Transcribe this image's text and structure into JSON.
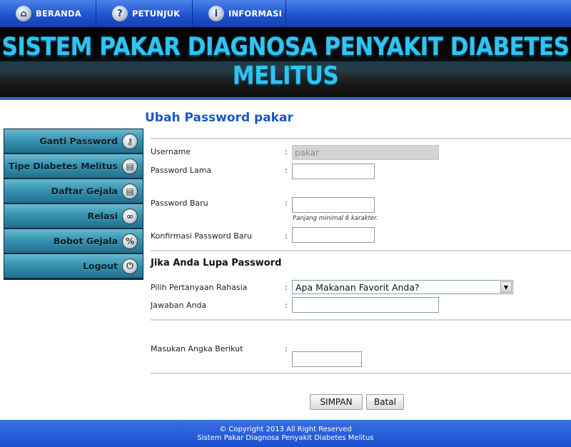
{
  "nav": {
    "items": [
      {
        "label": "BERANDA",
        "icon": "home-icon",
        "glyph": "⌂"
      },
      {
        "label": "PETUNJUK",
        "icon": "help-icon",
        "glyph": "?"
      },
      {
        "label": "INFORMASI",
        "icon": "info-icon",
        "glyph": "i"
      }
    ]
  },
  "banner": {
    "title": "SISTEM PAKAR DIAGNOSA PENYAKIT DIABETES MELITUS"
  },
  "sidebar": {
    "items": [
      {
        "label": "Ganti Password",
        "icon": "key-icon",
        "glyph": "⚷"
      },
      {
        "label": "Tipe Diabetes Melitus",
        "icon": "document-icon",
        "glyph": "▤"
      },
      {
        "label": "Daftar Gejala",
        "icon": "document-icon",
        "glyph": "▤"
      },
      {
        "label": "Relasi",
        "icon": "link-icon",
        "glyph": "∞"
      },
      {
        "label": "Bobot Gejala",
        "icon": "percent-icon",
        "glyph": "%"
      },
      {
        "label": "Logout",
        "icon": "power-icon",
        "glyph": "⏻"
      }
    ]
  },
  "form": {
    "title": "Ubah Password pakar",
    "colon": ":",
    "username": {
      "label": "Username",
      "value": "pakar"
    },
    "old_password": {
      "label": "Password Lama",
      "value": ""
    },
    "new_password": {
      "label": "Password Baru",
      "value": "",
      "hint": "Panjang minimal 6 karakter."
    },
    "confirm_password": {
      "label": "Konfirmasi Password Baru",
      "value": ""
    },
    "recovery": {
      "heading": "Jika Anda Lupa Password",
      "question_label": "Pilih Pertanyaan Rahasia",
      "question_selected": "Apa Makanan Favorit Anda?",
      "answer_label": "Jawaban Anda",
      "answer_value": ""
    },
    "captcha": {
      "label": "Masukan Angka Berikut",
      "value": ""
    },
    "buttons": {
      "save": "SIMPAN",
      "cancel": "Batal"
    }
  },
  "footer": {
    "line1": "© Copyright 2013 All Right Reserved",
    "line2": "Sistem Pakar Diagnosa Penyakit Diabetes Melitus"
  },
  "colors": {
    "nav": "#1e54cf",
    "banner_text": "#30c4f0",
    "sidebar": "#3694b1",
    "title": "#1a57c4",
    "footer": "#1a4fcf"
  }
}
